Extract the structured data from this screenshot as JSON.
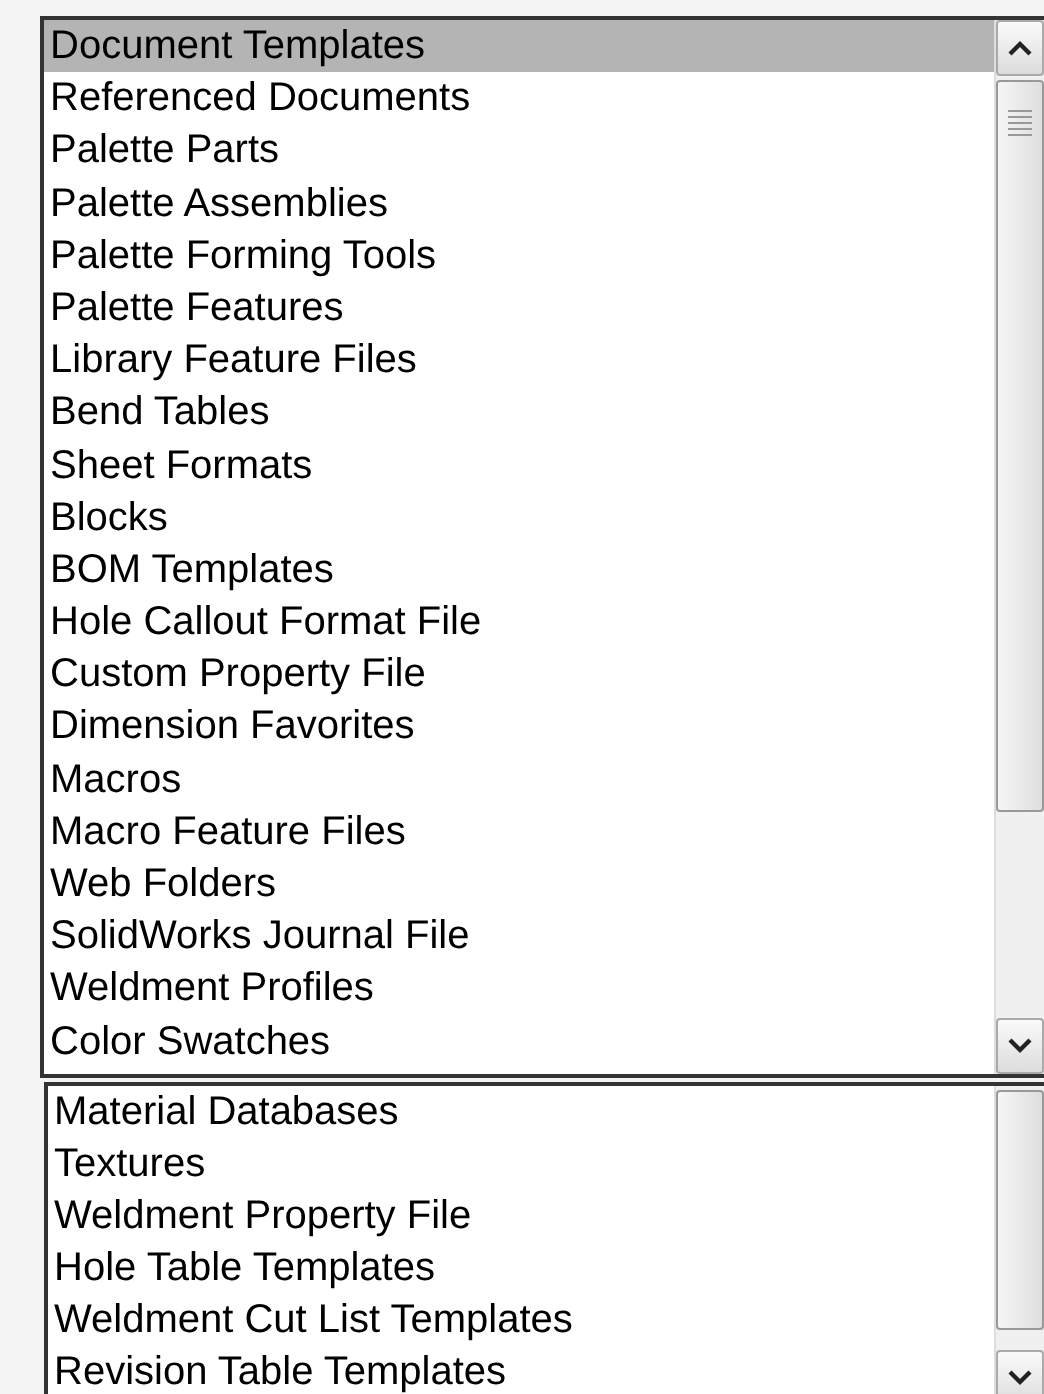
{
  "lists": [
    {
      "items": [
        {
          "label": "Document Templates",
          "selected": true
        },
        {
          "label": "Referenced Documents",
          "selected": false
        },
        {
          "label": "Palette Parts",
          "selected": false
        },
        {
          "label": "Palette Assemblies",
          "selected": false
        },
        {
          "label": "Palette Forming Tools",
          "selected": false
        },
        {
          "label": "Palette Features",
          "selected": false
        },
        {
          "label": "Library Feature Files",
          "selected": false
        },
        {
          "label": "Bend Tables",
          "selected": false
        },
        {
          "label": "Sheet Formats",
          "selected": false
        },
        {
          "label": "Blocks",
          "selected": false
        },
        {
          "label": "BOM Templates",
          "selected": false
        },
        {
          "label": "Hole Callout Format File",
          "selected": false
        },
        {
          "label": "Custom Property File",
          "selected": false
        },
        {
          "label": "Dimension Favorites",
          "selected": false
        },
        {
          "label": "Macros",
          "selected": false
        },
        {
          "label": "Macro Feature Files",
          "selected": false
        },
        {
          "label": "Web Folders",
          "selected": false
        },
        {
          "label": "SolidWorks Journal File",
          "selected": false
        },
        {
          "label": "Weldment Profiles",
          "selected": false
        },
        {
          "label": "Color Swatches",
          "selected": false
        }
      ]
    },
    {
      "items": [
        {
          "label": "Material Databases",
          "selected": false
        },
        {
          "label": "Textures",
          "selected": false
        },
        {
          "label": "Weldment Property File",
          "selected": false
        },
        {
          "label": "Hole Table Templates",
          "selected": false
        },
        {
          "label": "Weldment Cut List Templates",
          "selected": false
        },
        {
          "label": "Revision Table Templates",
          "selected": false
        }
      ]
    }
  ]
}
